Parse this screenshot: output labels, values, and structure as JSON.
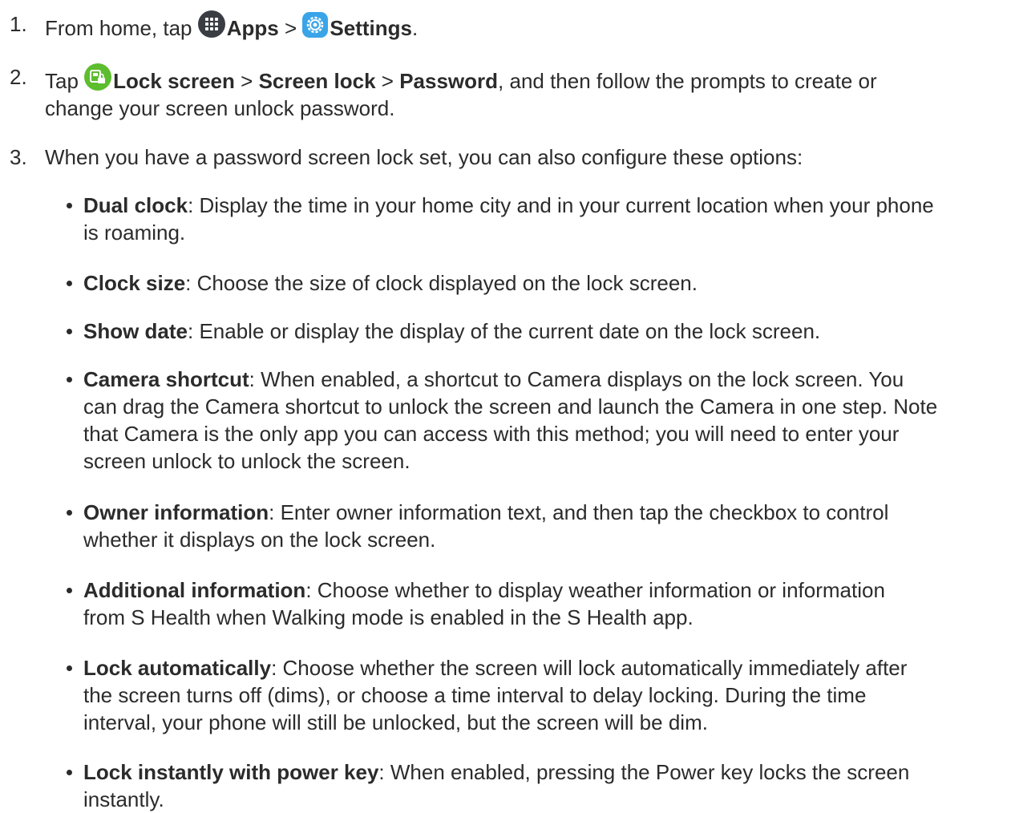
{
  "steps": [
    {
      "number": "1.",
      "prefix": "From home, tap",
      "apps_label": "Apps",
      "sep": ">",
      "settings_label": "Settings",
      "end": "."
    },
    {
      "number": "2.",
      "prefix": "Tap",
      "lock_screen_label": "Lock screen",
      "sep1": ">",
      "screen_lock_label": "Screen lock",
      "sep2": ">",
      "password_label": "Password",
      "rest_line1": ", and then follow the prompts to create or",
      "rest_line2": "change your screen unlock password."
    },
    {
      "number": "3.",
      "text": "When you have a password screen lock set, you can also configure these options:"
    }
  ],
  "options": [
    {
      "term": "Dual clock",
      "lines": [
        ": Display the time in your home city and in your current location when your phone",
        "is roaming."
      ]
    },
    {
      "term": "Clock size",
      "lines": [
        ": Choose the size of clock displayed on the lock screen."
      ]
    },
    {
      "term": "Show date",
      "lines": [
        ": Enable or display the display of the current date on the lock screen."
      ]
    },
    {
      "term": "Camera shortcut",
      "lines": [
        ": When enabled, a shortcut to Camera displays on the lock screen. You",
        "can drag the Camera shortcut to unlock the screen and launch the Camera in one step. Note",
        "that Camera is the only app you can access with this method; you will need to enter your",
        "screen unlock to unlock the screen."
      ]
    },
    {
      "term": "Owner information",
      "lines": [
        ": Enter owner information text, and then tap the checkbox to control",
        "whether it displays on the lock screen."
      ]
    },
    {
      "term": "Additional information",
      "lines": [
        ": Choose whether to display weather information or information",
        "from S Health when Walking mode is enabled in the S Health app."
      ]
    },
    {
      "term": "Lock automatically",
      "lines": [
        ": Choose whether the screen will lock automatically immediately after",
        "the screen turns off (dims), or choose a time interval to delay locking. During the time",
        "interval, your phone will still be unlocked, but the screen will be dim."
      ]
    },
    {
      "term": "Lock instantly with power key",
      "lines": [
        ": When enabled, pressing the Power key locks the screen",
        "instantly."
      ]
    }
  ],
  "icons": {
    "apps": "apps-grid-icon",
    "settings": "settings-gear-icon",
    "lock_screen": "lock-screen-icon"
  },
  "colors": {
    "text": "#2b2b2b",
    "apps_icon": "#3a3d44",
    "settings_icon": "#3aa4e8",
    "lock_icon": "#5cbd2e"
  }
}
